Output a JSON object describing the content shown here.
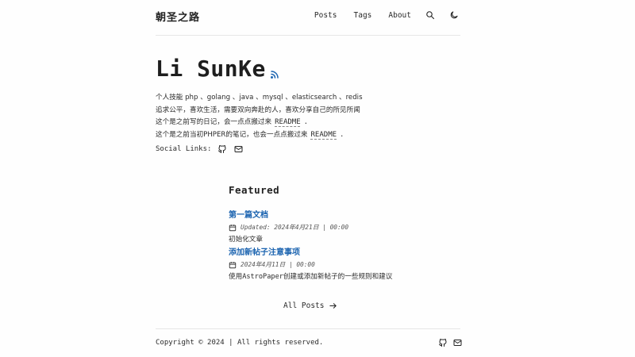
{
  "header": {
    "logo": "朝圣之路",
    "nav": [
      {
        "label": "Posts"
      },
      {
        "label": "Tags"
      },
      {
        "label": "About"
      }
    ],
    "icons": [
      "search-icon",
      "moon-icon"
    ]
  },
  "hero": {
    "title": "Li SunKe",
    "rss_icon": "rss-icon",
    "line1": "个人技能 php 、golang 、java 、mysql 、elasticsearch 、redis",
    "line2": "追求公平，喜欢生活，需要双向奔赴的人，喜欢分享自己的所见所闻",
    "line3_prefix": "这个是之前写的日记，会一点点搬过来",
    "line3_link": "README",
    "line3_suffix": ".",
    "line4_prefix": "这个是之前当初PHPER的笔记，也会一点点搬过来",
    "line4_link": "README",
    "line4_suffix": ".",
    "social_label": "Social Links:"
  },
  "featured": {
    "title": "Featured",
    "posts": [
      {
        "title": "第一篇文档",
        "meta": "Updated: 2024年4月21日 | 00:00",
        "desc": "初始化文章"
      },
      {
        "title": "添加新帖子注意事项",
        "meta": "2024年4月11日 | 00:00",
        "desc": "使用AstroPaper创建或添加新帖子的一些规则和建议"
      }
    ]
  },
  "all_posts": "All Posts",
  "footer": {
    "copyright": "Copyright © 2024 | All rights reserved."
  },
  "colors": {
    "accent": "#1c64b0",
    "text": "#2a2a2a",
    "background": "#fefefe"
  }
}
